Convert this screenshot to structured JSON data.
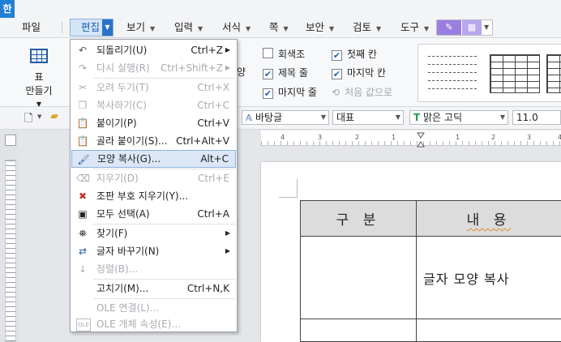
{
  "app": {
    "logo_glyph": "한",
    "accent_color": "#2a73c9"
  },
  "menubar": {
    "file": "파일",
    "edit": "편집",
    "view": "보기",
    "input": "입력",
    "format": "서식",
    "page": "쪽",
    "security": "보안",
    "review": "검토",
    "tools": "도구"
  },
  "ribbon": {
    "table_label_1": "표",
    "table_label_2": "만들기",
    "partial_label": "양",
    "checks": [
      {
        "label": "회색조",
        "checked": false,
        "enabled": true
      },
      {
        "label": "첫째 칸",
        "checked": true,
        "enabled": true
      },
      {
        "label": "제목 줄",
        "checked": true,
        "enabled": true
      },
      {
        "label": "마지막 칸",
        "checked": true,
        "enabled": true
      },
      {
        "label": "마지막 줄",
        "checked": true,
        "enabled": true
      },
      {
        "label": "처음 값으로",
        "checked": false,
        "enabled": false
      }
    ]
  },
  "formatbar": {
    "style": "바탕글",
    "lang": "대표",
    "font": "맑은 고딕",
    "size": "11.0"
  },
  "ruler": {
    "numbers": [
      "4",
      "3",
      "2",
      "1",
      "1",
      "2",
      "3",
      "4"
    ]
  },
  "document": {
    "header_col1": "구 분",
    "header_col2": "내 용",
    "cell_text": "글자 모양 복사"
  },
  "edit_menu": {
    "items": [
      {
        "icon": "undo-icon",
        "label": "되돌리기(U)",
        "shortcut": "Ctrl+Z",
        "submenu": true,
        "enabled": true
      },
      {
        "icon": "redo-icon",
        "label": "다시 실행(R)",
        "shortcut": "Ctrl+Shift+Z",
        "submenu": true,
        "enabled": false
      },
      {
        "icon": "cut-icon",
        "label": "오려 두기(T)",
        "shortcut": "Ctrl+X",
        "enabled": false
      },
      {
        "icon": "copy-icon",
        "label": "복사하기(C)",
        "shortcut": "Ctrl+C",
        "enabled": false
      },
      {
        "icon": "paste-icon",
        "label": "붙이기(P)",
        "shortcut": "Ctrl+V",
        "enabled": true
      },
      {
        "icon": "paste-special-icon",
        "label": "골라 붙이기(S)...",
        "shortcut": "Ctrl+Alt+V",
        "enabled": true
      },
      {
        "icon": "format-painter-icon",
        "label": "모양 복사(G)...",
        "shortcut": "Alt+C",
        "enabled": true,
        "highlighted": true
      },
      {
        "icon": "erase-icon",
        "label": "지우기(D)",
        "shortcut": "Ctrl+E",
        "enabled": false
      },
      {
        "icon": "remove-marks-icon",
        "label": "조판 부호 지우기(Y)...",
        "shortcut": "",
        "enabled": true
      },
      {
        "icon": "select-all-icon",
        "label": "모두 선택(A)",
        "shortcut": "Ctrl+A",
        "enabled": true
      },
      {
        "icon": "find-icon",
        "label": "찾기(F)",
        "shortcut": "",
        "submenu": true,
        "enabled": true
      },
      {
        "icon": "replace-icon",
        "label": "글자 바꾸기(N)",
        "shortcut": "",
        "submenu": true,
        "enabled": true
      },
      {
        "icon": "sort-icon",
        "label": "정렬(B)...",
        "shortcut": "",
        "enabled": false
      },
      {
        "icon": "",
        "label": "고치기(M)...",
        "shortcut": "Ctrl+N,K",
        "enabled": true
      },
      {
        "icon": "",
        "label": "OLE 연결(L)...",
        "shortcut": "",
        "enabled": false
      },
      {
        "icon": "ole-icon",
        "label": "OLE 개체 속성(E)...",
        "shortcut": "",
        "enabled": false
      }
    ]
  }
}
